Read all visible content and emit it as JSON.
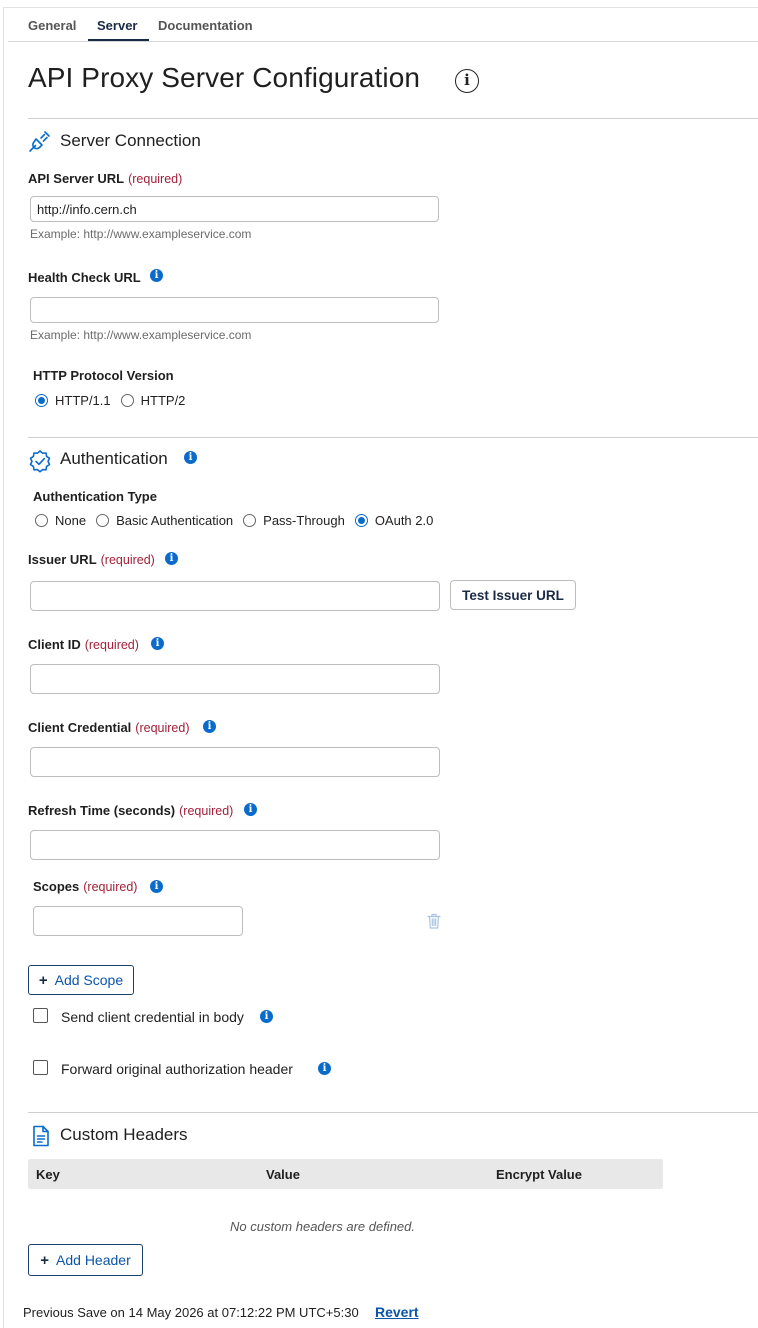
{
  "tabs": [
    {
      "label": "General"
    },
    {
      "label": "Server"
    },
    {
      "label": "Documentation"
    }
  ],
  "page_title": "API Proxy Server Configuration",
  "title_info_glyph": "i",
  "server_connection": {
    "title": "Server Connection",
    "icon": "plug-icon",
    "api_server_url": {
      "label": "API Server URL",
      "required": "(required)",
      "value": "http://info.cern.ch",
      "hint": "Example: http://www.exampleservice.com"
    },
    "health_check_url": {
      "label": "Health Check URL",
      "value": "",
      "hint": "Example: http://www.exampleservice.com"
    },
    "http_protocol": {
      "label": "HTTP Protocol Version",
      "options": [
        "HTTP/1.1",
        "HTTP/2"
      ],
      "selected": "HTTP/1.1"
    }
  },
  "authentication": {
    "title": "Authentication",
    "icon": "badge-check-icon",
    "auth_type": {
      "label": "Authentication Type",
      "options": [
        "None",
        "Basic Authentication",
        "Pass-Through",
        "OAuth 2.0"
      ],
      "selected": "OAuth 2.0"
    },
    "issuer_url": {
      "label": "Issuer URL",
      "required": "(required)",
      "value": "",
      "test_button": "Test Issuer URL"
    },
    "client_id": {
      "label": "Client ID",
      "required": "(required)",
      "value": ""
    },
    "client_credential": {
      "label": "Client Credential",
      "required": "(required)",
      "value": ""
    },
    "refresh_time": {
      "label": "Refresh Time (seconds)",
      "required": "(required)",
      "value": ""
    },
    "scopes": {
      "label": "Scopes",
      "required": "(required)",
      "value": "",
      "add_button": "Add Scope"
    },
    "send_credential_in_body": {
      "label": "Send client credential in body",
      "checked": false
    },
    "forward_auth_header": {
      "label": "Forward original authorization header",
      "checked": false
    }
  },
  "custom_headers": {
    "title": "Custom Headers",
    "icon": "document-icon",
    "columns": [
      "Key",
      "Value",
      "Encrypt Value"
    ],
    "empty_message": "No custom headers are defined.",
    "add_button": "Add Header"
  },
  "footer": {
    "previous_save": "Previous Save on 14 May 2026 at 07:12:22 PM UTC+5:30",
    "revert": "Revert"
  },
  "colors": {
    "accent": "#0b6bcb",
    "required": "#a1203a",
    "navy": "#1b2a44"
  }
}
